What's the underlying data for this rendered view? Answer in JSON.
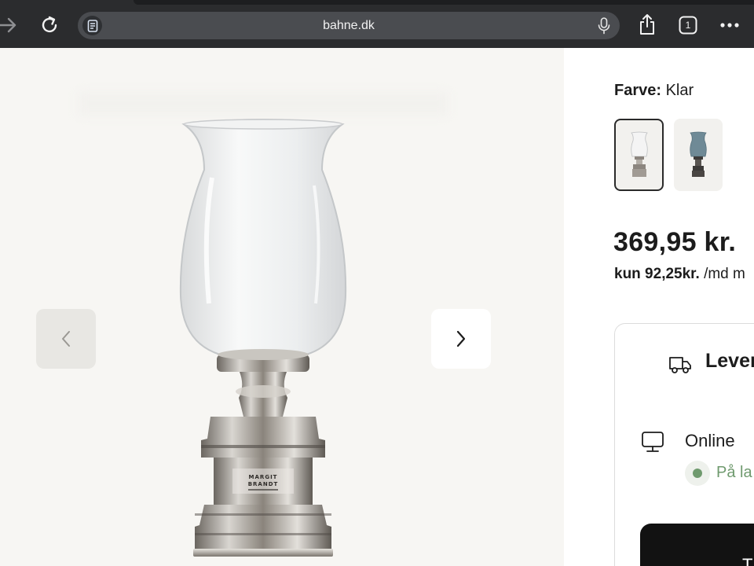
{
  "browser": {
    "url": "bahne.dk",
    "tab_count": "1"
  },
  "gallery": {
    "product_logo": [
      "MARGIT",
      "BRANDT"
    ]
  },
  "product": {
    "color_label": "Farve:",
    "color_value": "Klar",
    "price": "369,95 kr.",
    "installment_prefix": "kun 92,25kr.",
    "installment_suffix": " /md m",
    "delivery_title": "Lever",
    "online_label": "Online",
    "stock_status": "På la",
    "cta_label": "T"
  },
  "colors": {
    "chrome_bg": "#2b2c2e",
    "gallery_bg": "#f7f6f3",
    "stock_green": "#6f9a6e",
    "cta_bg": "#121212"
  }
}
